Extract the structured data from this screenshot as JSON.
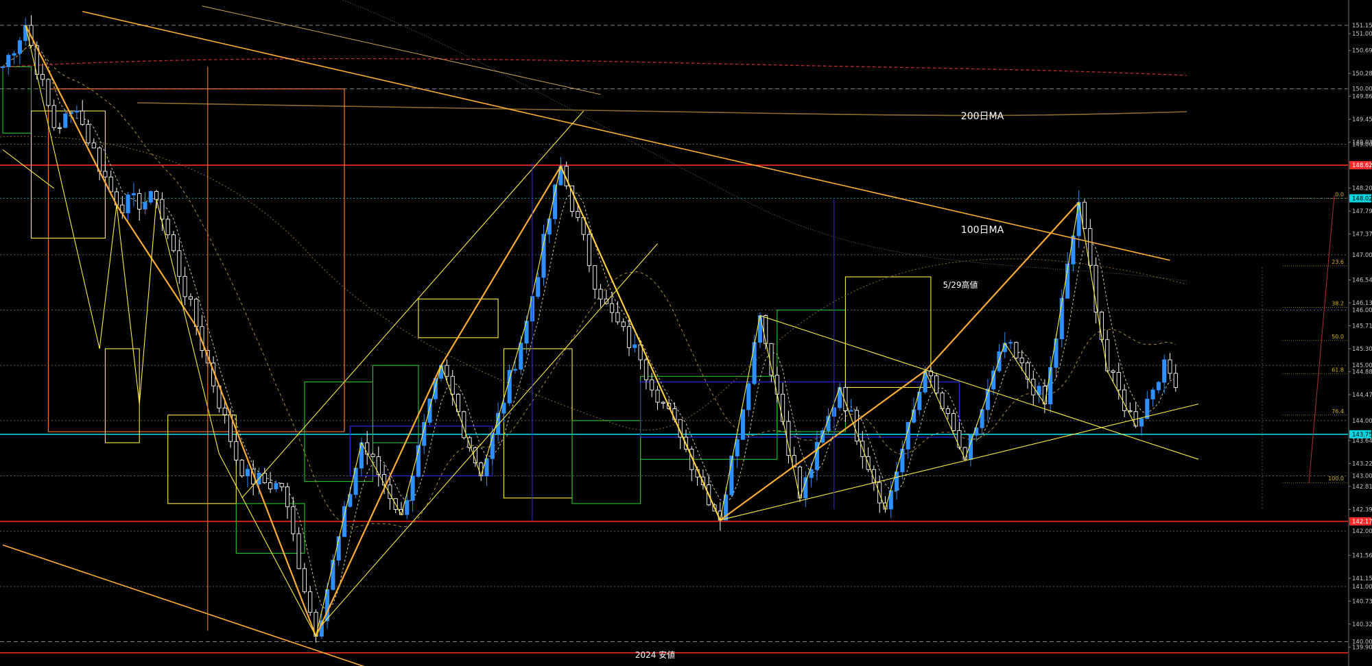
{
  "chart_data": {
    "type": "candlestick",
    "ylim": [
      139.71,
      151.36
    ],
    "y_ticks": [
      "151.000",
      "150.695",
      "150.280",
      "149.865",
      "149.450",
      "149.035",
      "148.205",
      "147.790",
      "147.375",
      "146.545",
      "146.130",
      "145.715",
      "145.300",
      "144.885",
      "144.470",
      "143.640",
      "143.225",
      "142.810",
      "142.395",
      "141.565",
      "141.150",
      "140.735",
      "140.320",
      "139.905"
    ],
    "price_tags": [
      {
        "text": "151.150",
        "value": 151.15,
        "bg": "#000000",
        "fg": "#c8c8c8"
      },
      {
        "text": "150.000",
        "value": 150.0,
        "bg": "#000000",
        "fg": "#c8c8c8"
      },
      {
        "text": "149.000",
        "value": 149.0,
        "bg": "#000000",
        "fg": "#c8c8c8"
      },
      {
        "text": "148.620",
        "value": 148.62,
        "bg": "#ff2a2a",
        "fg": "#ffffff"
      },
      {
        "text": "148.021",
        "value": 148.021,
        "bg": "#00d5e0",
        "fg": "#000000"
      },
      {
        "text": "147.000",
        "value": 147.0,
        "bg": "#000000",
        "fg": "#c8c8c8"
      },
      {
        "text": "146.000",
        "value": 146.0,
        "bg": "#000000",
        "fg": "#c8c8c8"
      },
      {
        "text": "145.000",
        "value": 145.0,
        "bg": "#000000",
        "fg": "#c8c8c8"
      },
      {
        "text": "144.000",
        "value": 144.0,
        "bg": "#000000",
        "fg": "#c8c8c8"
      },
      {
        "text": "143.753",
        "value": 143.753,
        "bg": "#00d5e0",
        "fg": "#000000"
      },
      {
        "text": "143.000",
        "value": 143.0,
        "bg": "#000000",
        "fg": "#c8c8c8"
      },
      {
        "text": "142.178",
        "value": 142.178,
        "bg": "#ff2a2a",
        "fg": "#ffffff"
      },
      {
        "text": "142.000",
        "value": 142.0,
        "bg": "#000000",
        "fg": "#c8c8c8"
      },
      {
        "text": "141.000",
        "value": 141.0,
        "bg": "#000000",
        "fg": "#c8c8c8"
      },
      {
        "text": "140.000",
        "value": 140.0,
        "bg": "#000000",
        "fg": "#c8c8c8"
      }
    ],
    "horizontal_levels": [
      {
        "value": 148.62,
        "color": "#ff2a2a",
        "style": "solid"
      },
      {
        "value": 148.021,
        "color": "#00d5e0",
        "style": "dotted"
      },
      {
        "value": 143.753,
        "color": "#00d5e0",
        "style": "solid"
      },
      {
        "value": 142.178,
        "color": "#ff2a2a",
        "style": "solid"
      },
      {
        "value": 139.8,
        "color": "#ff2a2a",
        "style": "solid"
      },
      {
        "value": 151.15,
        "color": "#9a9a9a",
        "style": "dashed"
      },
      {
        "value": 150.0,
        "color": "#9a9a9a",
        "style": "dashed"
      },
      {
        "value": 140.0,
        "color": "#9a9a9a",
        "style": "dashed"
      },
      {
        "value": 149.0,
        "color": "#8a8a8a",
        "style": "dotted"
      },
      {
        "value": 147.0,
        "color": "#8a8a8a",
        "style": "dotted"
      },
      {
        "value": 146.0,
        "color": "#8a8a8a",
        "style": "dotted"
      },
      {
        "value": 145.0,
        "color": "#8a8a8a",
        "style": "dotted"
      },
      {
        "value": 144.0,
        "color": "#8a8a8a",
        "style": "dotted"
      },
      {
        "value": 143.0,
        "color": "#8a8a8a",
        "style": "dotted"
      },
      {
        "value": 142.0,
        "color": "#8a8a8a",
        "style": "dotted"
      },
      {
        "value": 141.0,
        "color": "#8a8a8a",
        "style": "dotted"
      }
    ],
    "anchors": [
      [
        0,
        150.4
      ],
      [
        4,
        151.15
      ],
      [
        9,
        149.3
      ],
      [
        13,
        149.6
      ],
      [
        20,
        147.9
      ],
      [
        27,
        148.0
      ],
      [
        34,
        145.7
      ],
      [
        42,
        143.0
      ],
      [
        49,
        142.8
      ],
      [
        55,
        140.1
      ],
      [
        63,
        143.6
      ],
      [
        70,
        142.3
      ],
      [
        77,
        145.0
      ],
      [
        84,
        143.0
      ],
      [
        92,
        145.8
      ],
      [
        98,
        148.6
      ],
      [
        105,
        146.2
      ],
      [
        112,
        145.1
      ],
      [
        119,
        143.7
      ],
      [
        126,
        142.2
      ],
      [
        133,
        145.9
      ],
      [
        140,
        142.6
      ],
      [
        147,
        144.6
      ],
      [
        155,
        142.4
      ],
      [
        162,
        144.9
      ],
      [
        169,
        143.3
      ],
      [
        176,
        145.4
      ],
      [
        183,
        144.3
      ],
      [
        189,
        147.95
      ],
      [
        194,
        144.9
      ],
      [
        199,
        143.9
      ],
      [
        204,
        145.1
      ],
      [
        206,
        144.6
      ]
    ],
    "fib_levels": [
      {
        "label": "0.0",
        "value": 148.021
      },
      {
        "label": "23.6",
        "value": 146.8
      },
      {
        "label": "38.2",
        "value": 146.05
      },
      {
        "label": "50.0",
        "value": 145.45
      },
      {
        "label": "61.8",
        "value": 144.85
      },
      {
        "label": "76.4",
        "value": 144.1
      },
      {
        "label": "100.0",
        "value": 142.88
      }
    ],
    "annotations": [
      {
        "text": "200日MA",
        "x": 1432,
        "y": 174
      },
      {
        "text": "100日MA",
        "x": 1432,
        "y": 340
      },
      {
        "text": "5/29高値",
        "x": 1400,
        "y": 420
      },
      {
        "text": "2024 安値",
        "x": 955,
        "y": 960
      }
    ],
    "colors": {
      "background": "#000000",
      "candle_up": "#2f8fff",
      "candle_down": "#ffffff",
      "trend_orange": "#ffad33",
      "trend_yellow": "#ffee44",
      "box_green": "#28c828",
      "box_blue": "#2a2aff",
      "box_orange": "#ff7a2a",
      "support_red": "#ff2a2a",
      "support_cyan": "#00d5e0"
    }
  }
}
